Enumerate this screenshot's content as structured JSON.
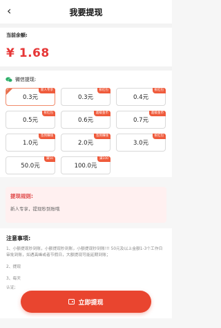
{
  "header": {
    "back_icon": "chevron-left-icon",
    "title": "我要提现"
  },
  "balance": {
    "label": "当前余额:",
    "amount": "¥ 1.68"
  },
  "withdraw": {
    "label": "微信提现:",
    "options": [
      {
        "amount": "0.3元",
        "badge": "新人专享",
        "selected": true
      },
      {
        "amount": "0.3元",
        "badge": "拆红包",
        "selected": false
      },
      {
        "amount": "0.4元",
        "badge": "拆红包",
        "selected": false
      },
      {
        "amount": "0.5元",
        "badge": "拆红包",
        "selected": false
      },
      {
        "amount": "0.6元",
        "badge": "超级金币",
        "selected": false
      },
      {
        "amount": "0.7元",
        "badge": "超级金币",
        "selected": false
      },
      {
        "amount": "1.0元",
        "badge": "签到赚钱",
        "selected": false
      },
      {
        "amount": "2.0元",
        "badge": "签到赚钱",
        "selected": false
      },
      {
        "amount": "3.0元",
        "badge": "拆红包",
        "selected": false
      },
      {
        "amount": "50.0元",
        "badge": "满50",
        "selected": false
      },
      {
        "amount": "100.0元",
        "badge": "满100",
        "selected": false
      }
    ]
  },
  "rules": {
    "title": "提现规则:",
    "body": "新人专享，提现秒到账哦"
  },
  "notes": {
    "title": "注意事项:",
    "items": [
      "1、小额提现秒到账，小额提现秒到账，小额提现秒到账!!! 50元及以上金额1-3个工作日审批到账，如遇高峰或者节假日，大额提现可能延期到账；",
      "2、提现",
      "3、每天",
      "认证;"
    ]
  },
  "cta": {
    "label": "立即提现",
    "icon": "wallet-icon"
  },
  "colors": {
    "accent": "#e9452f",
    "amount": "#e63636",
    "badge": "#ef5b3c",
    "wechat": "#2aae67"
  }
}
